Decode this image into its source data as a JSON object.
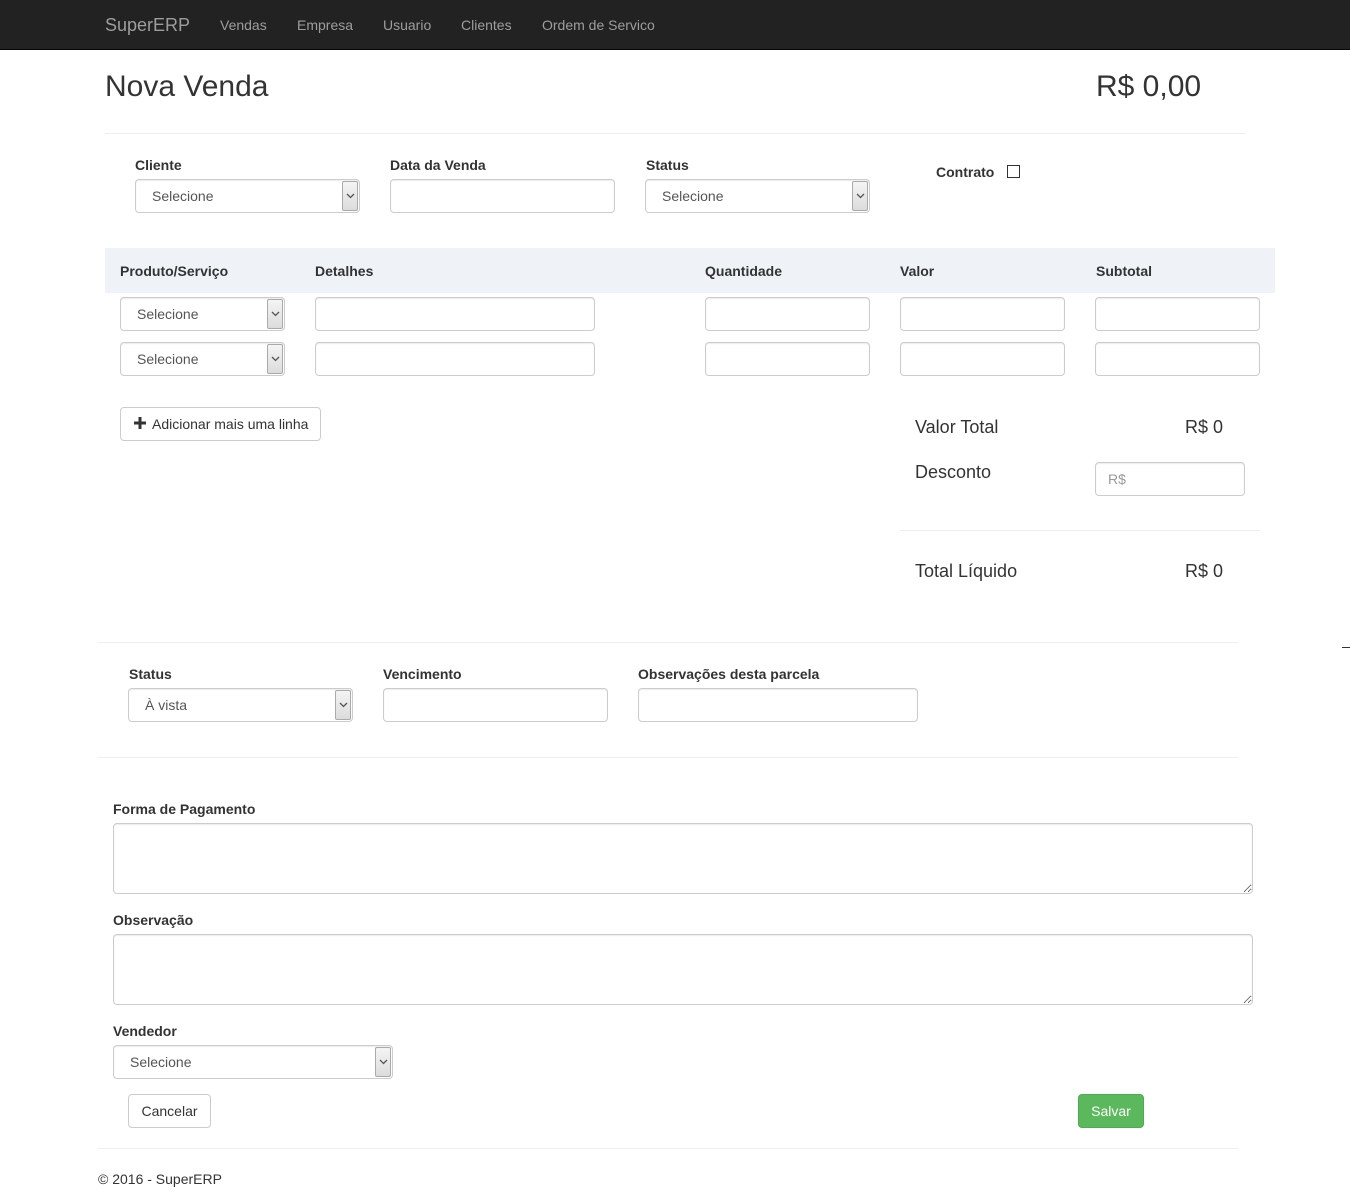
{
  "navbar": {
    "brand": "SuperERP",
    "links": [
      "Vendas",
      "Empresa",
      "Usuario",
      "Clientes",
      "Ordem de Servico"
    ]
  },
  "header": {
    "title": "Nova Venda",
    "total": "R$ 0,00"
  },
  "top_form": {
    "cliente_label": "Cliente",
    "cliente_value": "Selecione",
    "data_label": "Data da Venda",
    "data_value": "",
    "status_label": "Status",
    "status_value": "Selecione",
    "contrato_label": "Contrato",
    "contrato_checked": false
  },
  "items_table": {
    "headers": [
      "Produto/Serviço",
      "Detalhes",
      "Quantidade",
      "Valor",
      "Subtotal"
    ],
    "rows": [
      {
        "produto": "Selecione",
        "detalhes": "",
        "quantidade": "",
        "valor": "",
        "subtotal": ""
      },
      {
        "produto": "Selecione",
        "detalhes": "",
        "quantidade": "",
        "valor": "",
        "subtotal": ""
      }
    ],
    "add_line_label": "Adicionar mais uma linha"
  },
  "summary": {
    "valor_total_label": "Valor Total",
    "valor_total": "R$ 0",
    "desconto_label": "Desconto",
    "desconto_placeholder": "R$",
    "total_liquido_label": "Total Líquido",
    "total_liquido": "R$ 0"
  },
  "parcela": {
    "status_label": "Status",
    "status_value": "À vista",
    "vencimento_label": "Vencimento",
    "vencimento_value": "",
    "observacoes_label": "Observações desta parcela",
    "observacoes_value": ""
  },
  "bottom_form": {
    "forma_pagamento_label": "Forma de Pagamento",
    "observacao_label": "Observação",
    "vendedor_label": "Vendedor",
    "vendedor_value": "Selecione"
  },
  "actions": {
    "cancel_label": "Cancelar",
    "save_label": "Salvar"
  },
  "colors": {
    "navbar_bg": "#222222",
    "success": "#5cb85c",
    "table_head_bg": "#eff3f7"
  },
  "footer": {
    "text": "© 2016 - SuperERP"
  }
}
